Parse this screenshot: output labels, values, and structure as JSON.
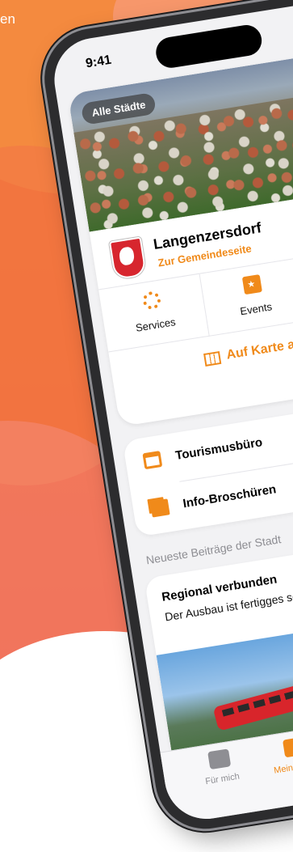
{
  "backdrop": {
    "partial_text": "en"
  },
  "status_bar": {
    "time": "9:41"
  },
  "city_card": {
    "all_cities_pill": "Alle Städte",
    "town_name": "Langenzersdorf",
    "town_link": "Zur Gemeindeseite",
    "services_label": "Services",
    "events_label": "Events",
    "map_label": "Auf Karte an"
  },
  "links": [
    {
      "label": "Tourismusbüro",
      "icon": "shop-icon"
    },
    {
      "label": "Info-Broschüren",
      "icon": "document-icon"
    }
  ],
  "section_title": "Neueste Beiträge der Stadt",
  "post": {
    "title": "Regional verbunden",
    "text": "Der Ausbau ist fertigges somit kann die neue Str"
  },
  "tabbar": {
    "for_me": "Für mich",
    "my_city": "Meine Stadt"
  },
  "colors": {
    "accent": "#f08a1a",
    "background_orange": "#ee5a2c"
  }
}
